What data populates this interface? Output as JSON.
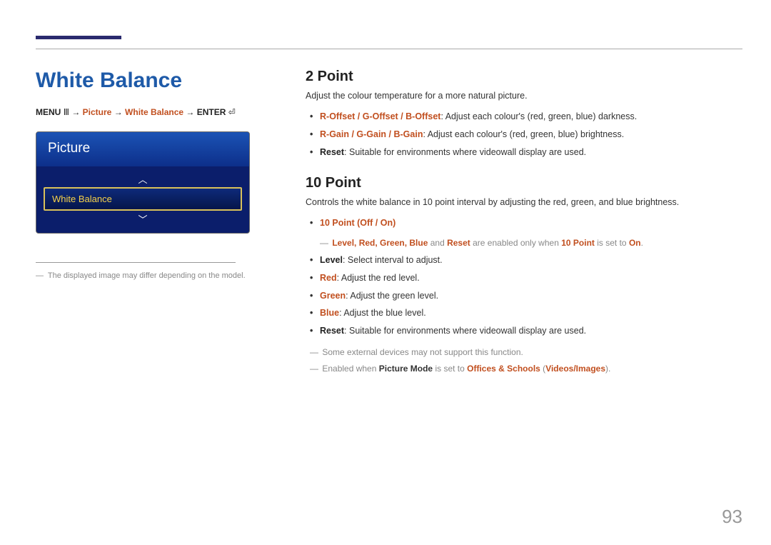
{
  "page_number": "93",
  "left": {
    "title": "White Balance",
    "breadcrumb": {
      "menu": "MENU",
      "picture": "Picture",
      "white_balance": "White Balance",
      "enter": "ENTER",
      "arrow": "→"
    },
    "osd": {
      "header": "Picture",
      "item": "White Balance"
    },
    "note": "The displayed image may differ depending on the model."
  },
  "right": {
    "s1": {
      "heading": "2 Point",
      "lead": "Adjust the colour temperature for a more natural picture.",
      "items": {
        "offset_labels": "R-Offset / G-Offset / B-Offset",
        "offset_desc": ": Adjust each colour's (red, green, blue) darkness.",
        "gain_labels": "R-Gain / G-Gain / B-Gain",
        "gain_desc": ": Adjust each colour's (red, green, blue) brightness.",
        "reset_label": "Reset",
        "reset_desc": ": Suitable for environments where videowall display are used."
      }
    },
    "s2": {
      "heading": "10 Point",
      "lead": "Controls the white balance in 10 point interval by adjusting the red, green, and blue brightness.",
      "items": {
        "tenpoint_label": "10 Point",
        "tenpoint_opts": " (Off / On)",
        "sub_prefix_levels": "Level, Red, Green, Blue",
        "sub_and": " and ",
        "sub_reset": "Reset",
        "sub_mid": " are enabled only when ",
        "sub_tp": "10 Point",
        "sub_mid2": " is set to ",
        "sub_on": "On",
        "sub_end": ".",
        "level_label": "Level",
        "level_desc": ": Select interval to adjust.",
        "red_label": "Red",
        "red_desc": ": Adjust the red level.",
        "green_label": "Green",
        "green_desc": ": Adjust the green level.",
        "blue_label": "Blue",
        "blue_desc": ": Adjust the blue level.",
        "reset_label": "Reset",
        "reset_desc": ": Suitable for environments where videowall display are used."
      },
      "foot1": "Some external devices may not support this function.",
      "foot2": {
        "pre": "Enabled when ",
        "pm": "Picture Mode",
        "mid": " is set to ",
        "v1": "Offices & Schools",
        "paren_open": " (",
        "v2": "Videos/Images",
        "paren_close": ")."
      }
    }
  }
}
